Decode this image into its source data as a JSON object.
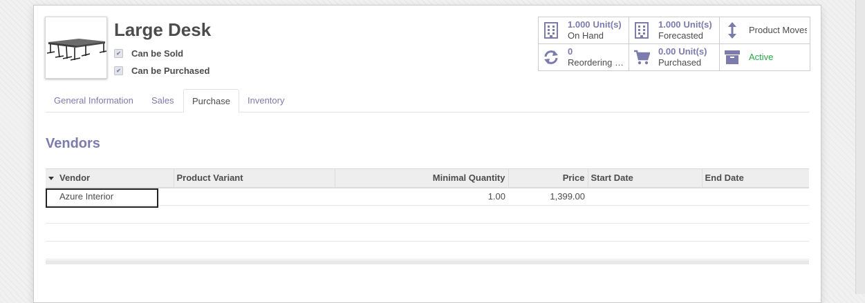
{
  "product": {
    "name": "Large Desk",
    "can_be_sold_label": "Can be Sold",
    "can_be_purchased_label": "Can be Purchased",
    "can_be_sold": true,
    "can_be_purchased": true,
    "image_icon": "desk-image"
  },
  "smart_buttons": {
    "on_hand": {
      "value": "1.000",
      "unit": "Unit(s)",
      "label": "On Hand",
      "icon": "building-icon"
    },
    "forecasted": {
      "value": "1.000",
      "unit": "Unit(s)",
      "label": "Forecasted",
      "icon": "building-icon"
    },
    "product_moves": {
      "label": "Product Moves",
      "icon": "up-down-arrow-icon"
    },
    "reordering": {
      "value": "0",
      "label": "Reordering R…",
      "icon": "refresh-icon"
    },
    "purchased": {
      "value": "0.00",
      "unit": "Unit(s)",
      "label": "Purchased",
      "icon": "cart-icon"
    },
    "active": {
      "label": "Active",
      "icon": "archive-box-icon"
    }
  },
  "tabs": [
    {
      "label": "General Information",
      "active": false
    },
    {
      "label": "Sales",
      "active": false
    },
    {
      "label": "Purchase",
      "active": true
    },
    {
      "label": "Inventory",
      "active": false
    }
  ],
  "vendors": {
    "title": "Vendors",
    "columns": [
      "Vendor",
      "Product Variant",
      "Minimal Quantity",
      "Price",
      "Start Date",
      "End Date"
    ],
    "rows": [
      {
        "vendor": "Azure Interior",
        "variant": "",
        "min_qty": "1.00",
        "price": "1,399.00",
        "start_date": "",
        "end_date": ""
      }
    ]
  },
  "colors": {
    "accent": "#7c7bad",
    "active_green": "#28a745",
    "text": "#4c4c4c"
  }
}
